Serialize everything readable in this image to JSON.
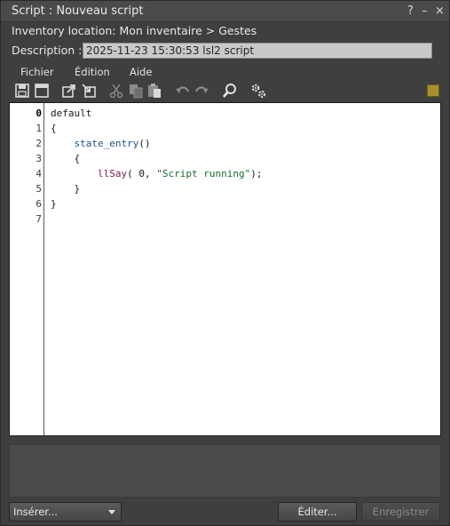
{
  "window": {
    "title": "Script : Nouveau script",
    "controls": {
      "help": "?",
      "minimize": "–",
      "close": "×"
    }
  },
  "inventory_location": "Inventory location: Mon inventaire > Gestes",
  "description": {
    "label": "Description :",
    "value": "2025-11-23 15:30:53 lsl2 script"
  },
  "menus": [
    "Fichier",
    "Édition",
    "Aide"
  ],
  "toolbar": {
    "icons": [
      "save-icon",
      "save-as-icon",
      "external-editor-icon",
      "load-from-file-icon",
      "cut-icon",
      "copy-icon",
      "paste-icon",
      "undo-icon",
      "redo-icon",
      "search-icon",
      "settings-icon"
    ],
    "status_color": "#a8912c"
  },
  "editor": {
    "line_numbers": [
      "0",
      "1",
      "2",
      "3",
      "4",
      "5",
      "6",
      "7"
    ],
    "active_line": "0",
    "lines": [
      [
        {
          "t": "default",
          "c": "kw"
        }
      ],
      [
        {
          "t": "{",
          "c": "kw"
        }
      ],
      [
        {
          "t": "    ",
          "c": "kw"
        },
        {
          "t": "state_entry",
          "c": "ev"
        },
        {
          "t": "()",
          "c": "kw"
        }
      ],
      [
        {
          "t": "    {",
          "c": "kw"
        }
      ],
      [
        {
          "t": "        ",
          "c": "kw"
        },
        {
          "t": "llSay",
          "c": "fn"
        },
        {
          "t": "( 0, ",
          "c": "kw"
        },
        {
          "t": "\"Script running\"",
          "c": "str"
        },
        {
          "t": ");",
          "c": "kw"
        }
      ],
      [
        {
          "t": "    }",
          "c": "kw"
        }
      ],
      [
        {
          "t": "}",
          "c": "kw"
        }
      ],
      []
    ]
  },
  "bottom": {
    "insert_label": "Insérer...",
    "edit_label": "Éditer...",
    "save_label": "Enregistrer"
  }
}
